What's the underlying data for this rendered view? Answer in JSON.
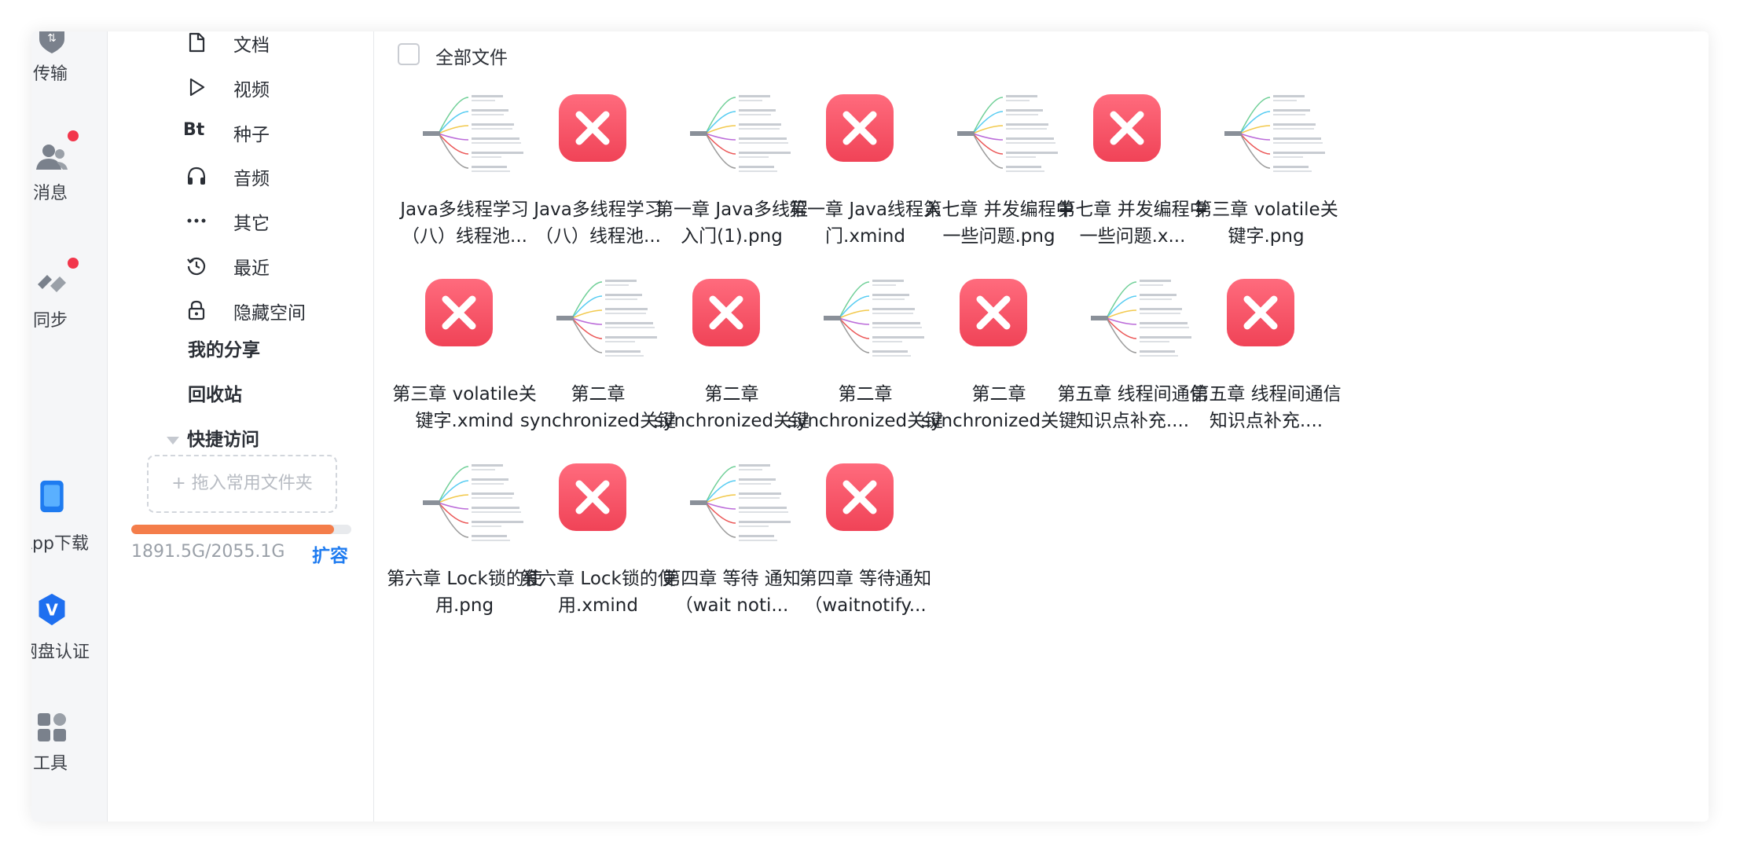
{
  "rail": {
    "transfer": "传输",
    "messages": "消息",
    "sync": "同步",
    "app_download": "App下载",
    "verify": "网盘认证",
    "tools": "工具"
  },
  "sidebar": {
    "items": [
      {
        "label": "文档",
        "icon": "document-icon"
      },
      {
        "label": "视频",
        "icon": "play-icon"
      },
      {
        "label": "种子",
        "icon": "bt-icon"
      },
      {
        "label": "音频",
        "icon": "headphones-icon"
      },
      {
        "label": "其它",
        "icon": "more-icon"
      },
      {
        "label": "最近",
        "icon": "history-icon"
      },
      {
        "label": "隐藏空间",
        "icon": "lock-icon"
      }
    ],
    "bt_glyph": "Bt",
    "my_share": "我的分享",
    "recycle": "回收站",
    "quick_access": "快捷访问",
    "drop_hint": "+ 拖入常用文件夹",
    "storage_used_fraction": 0.92,
    "storage_text": "1891.5G/2055.1G",
    "expand": "扩容",
    "colors": {
      "bar": "#f47d4a",
      "accent": "#1e7bf0"
    }
  },
  "toolbar": {
    "select_all": "全部文件"
  },
  "files": [
    {
      "name": "Java多线程学习（八）线程池...",
      "type": "png"
    },
    {
      "name": "Java多线程学习（八）线程池...",
      "type": "error"
    },
    {
      "name": "第一章 Java多线程入门(1).png",
      "type": "png"
    },
    {
      "name": "第一章 Java线程入门.xmind",
      "type": "error"
    },
    {
      "name": "第七章 并发编程中一些问题.png",
      "type": "png"
    },
    {
      "name": "第七章 并发编程中一些问题.x...",
      "type": "error"
    },
    {
      "name": "第三章 volatile关键字.png",
      "type": "png"
    },
    {
      "name": "第三章 volatile关键字.xmind",
      "type": "error"
    },
    {
      "name": "第二章 synchronized关键字...",
      "type": "png"
    },
    {
      "name": "第二章 synchronized关键字...",
      "type": "error"
    },
    {
      "name": "第二章 synchronized关键字...",
      "type": "png"
    },
    {
      "name": "第二章 synchronized关键字...",
      "type": "error"
    },
    {
      "name": "第五章 线程间通信知识点补充....",
      "type": "png"
    },
    {
      "name": "第五章 线程间通信知识点补充....",
      "type": "error"
    },
    {
      "name": "第六章 Lock锁的使用.png",
      "type": "png"
    },
    {
      "name": "第六章 Lock锁的使用.xmind",
      "type": "error"
    },
    {
      "name": "第四章 等待 通知（wait noti...",
      "type": "png"
    },
    {
      "name": "第四章 等待通知（waitnotify...",
      "type": "error"
    }
  ]
}
